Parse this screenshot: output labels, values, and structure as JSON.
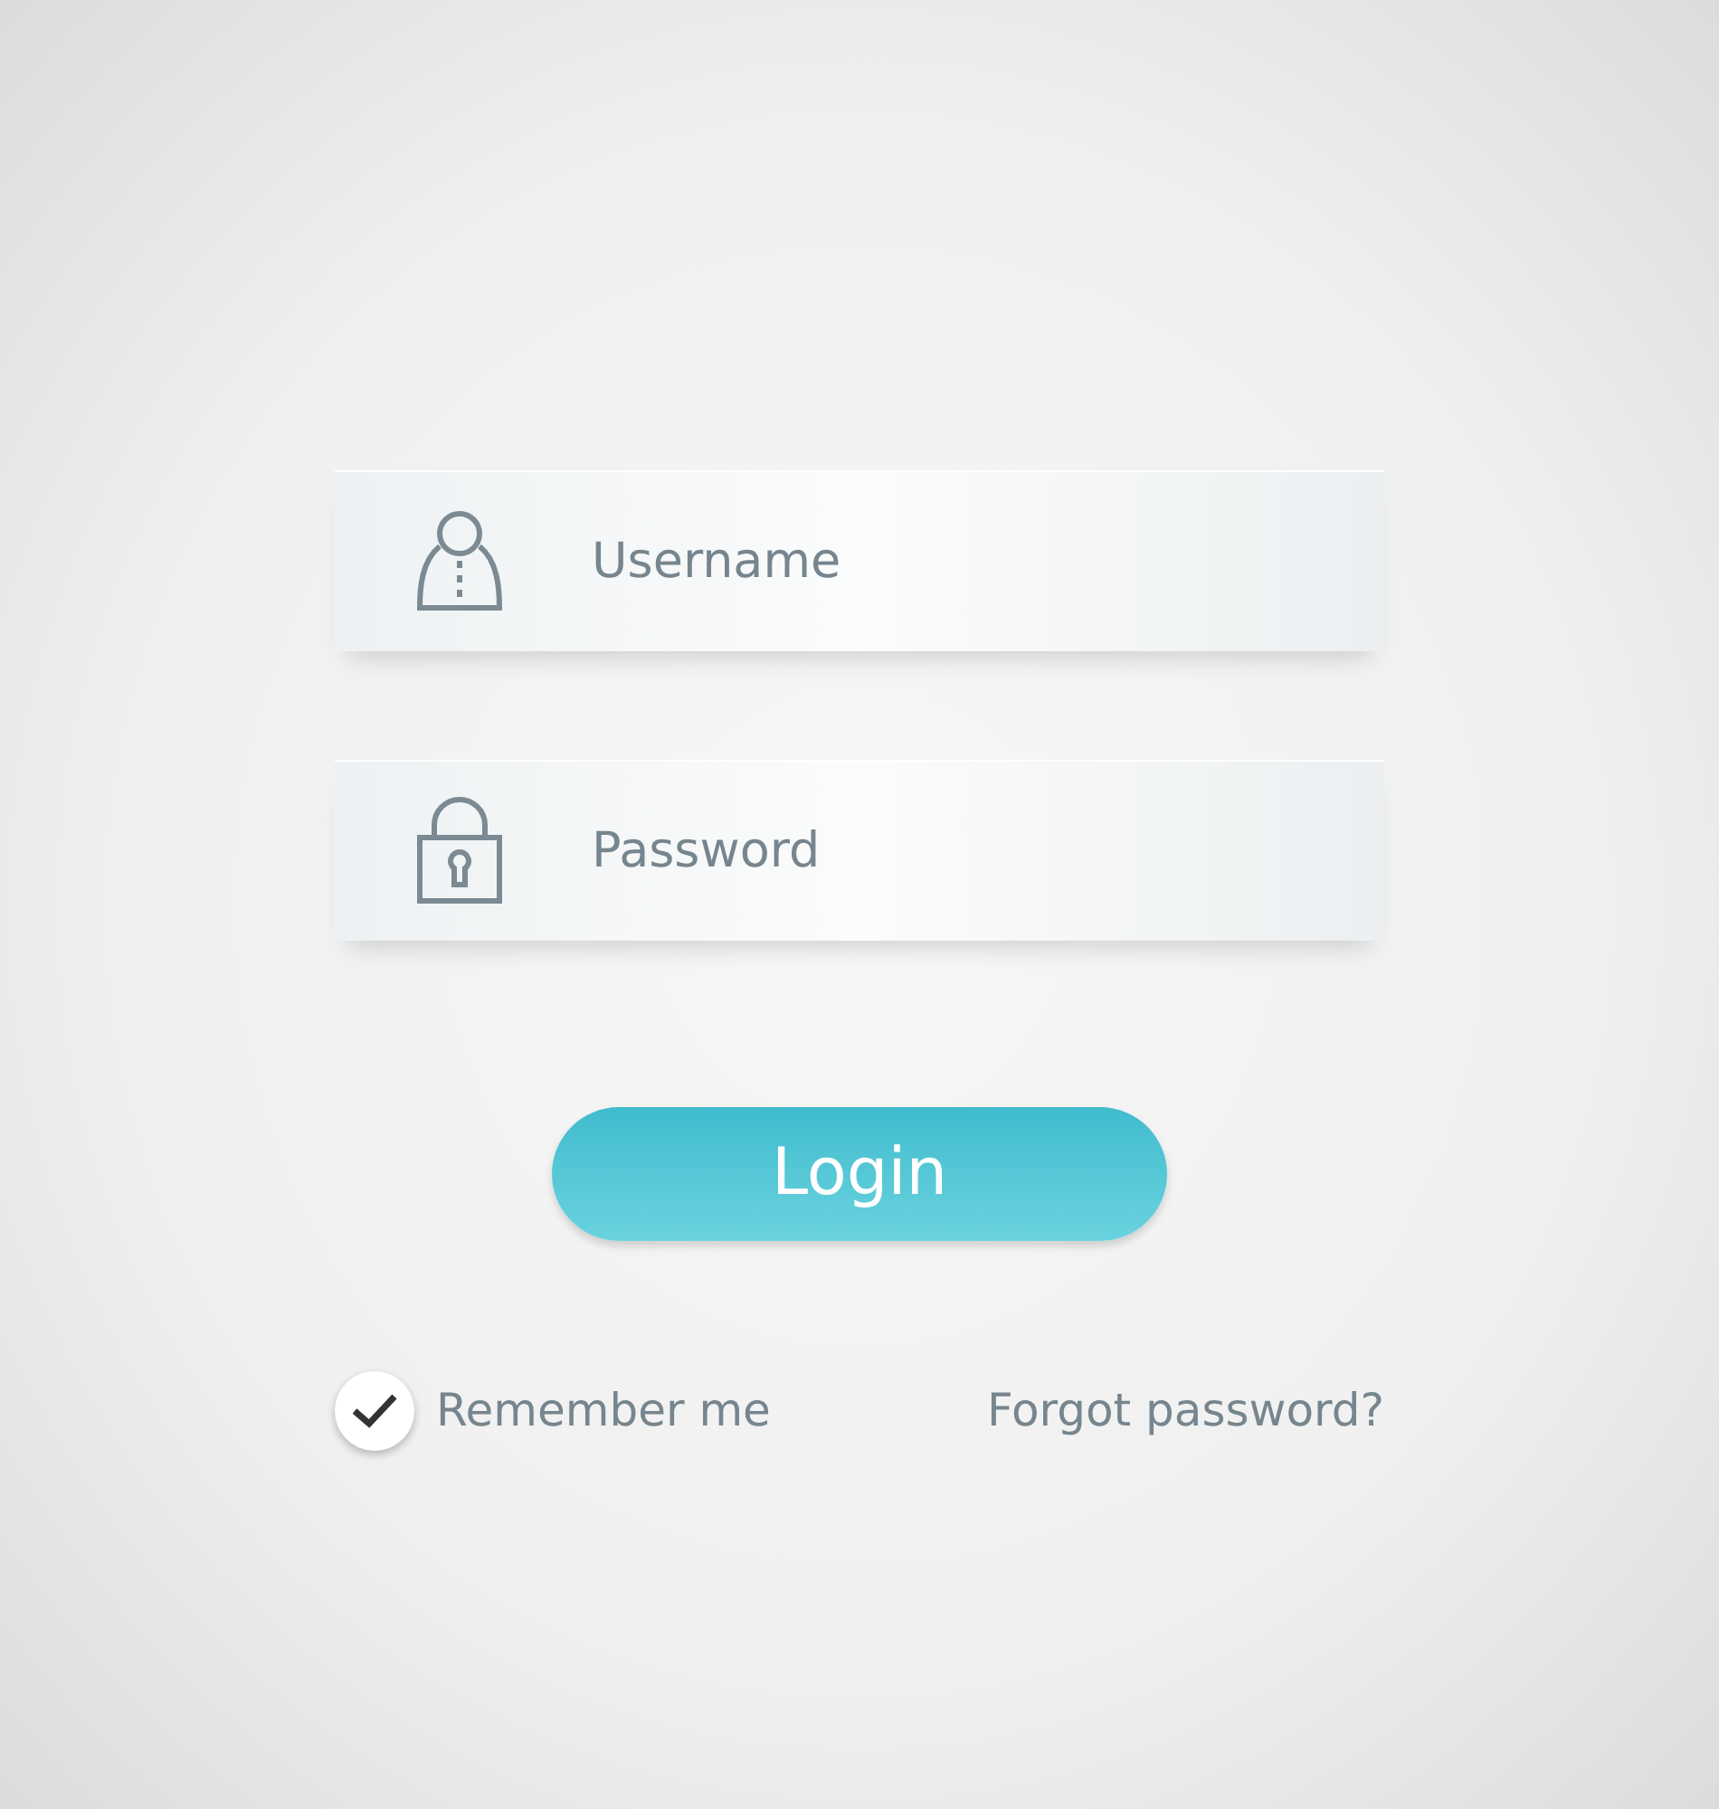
{
  "username": {
    "placeholder": "Username"
  },
  "password": {
    "placeholder": "Password"
  },
  "login_button": {
    "label": "Login"
  },
  "remember_me": {
    "label": "Remember me",
    "checked": true
  },
  "forgot_password": {
    "label": "Forgot password?"
  }
}
